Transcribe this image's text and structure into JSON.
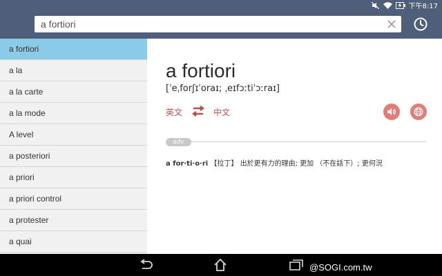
{
  "status_bar": {
    "time": "下午8:17",
    "icons": [
      "mute-icon",
      "wifi-icon",
      "battery-charging-icon"
    ]
  },
  "search": {
    "query": "a fortiori",
    "clear_icon": "close-icon",
    "history_icon": "clock-icon"
  },
  "word_list": [
    {
      "label": "a fortiori",
      "selected": true
    },
    {
      "label": "a la",
      "selected": false
    },
    {
      "label": "a la carte",
      "selected": false
    },
    {
      "label": "a la mode",
      "selected": false
    },
    {
      "label": "A level",
      "selected": false
    },
    {
      "label": "a posteriori",
      "selected": false
    },
    {
      "label": "a priori",
      "selected": false
    },
    {
      "label": "a priori control",
      "selected": false
    },
    {
      "label": "a protester",
      "selected": false
    },
    {
      "label": "a quai",
      "selected": false
    }
  ],
  "entry": {
    "headword": "a fortiori",
    "phonetic": "[ˈeˌforʃɪˈoraɪ; ˌeɪfɔːtiˈɔːraɪ]",
    "source_language": "英文",
    "target_language": "中文",
    "part_of_speech": "adv",
    "definition_word": "a for·ti·o·ri",
    "definition_text": "【拉丁】 出於更有力的理由; 更加 （不在話下）; 更何況"
  },
  "colors": {
    "header": "#4f5f7a",
    "selected_row": "#8ccbe8",
    "accent": "#b5524c",
    "round_button": "#e07e7a"
  },
  "nav_bar": {
    "icons": [
      "back-icon",
      "home-icon",
      "recent-apps-icon"
    ],
    "watermark": "@SOGI.com.tw"
  }
}
